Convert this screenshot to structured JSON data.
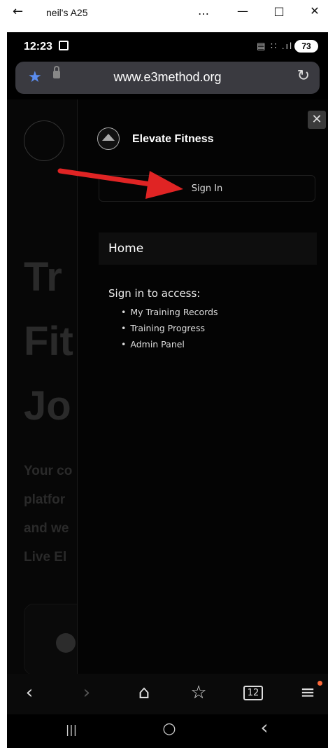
{
  "window": {
    "title": "neil's A25",
    "back_glyph": "←",
    "more_glyph": "…",
    "min_glyph": "—",
    "max_glyph": "□",
    "close_glyph": "✕"
  },
  "status": {
    "time": "12:23",
    "battery": "73",
    "signal_icons": "▤ ∷ .ıl"
  },
  "urlbar": {
    "url": "www.e3method.org",
    "star": "★",
    "reload": "↻"
  },
  "page": {
    "hero_lines": [
      "Tr",
      "Fit",
      "Jo"
    ],
    "sub_lines": [
      "Your co",
      "platfor",
      "and we",
      "Live El"
    ]
  },
  "drawer": {
    "close": "✕",
    "brand": "Elevate Fitness",
    "signin": "Sign In",
    "home": "Home",
    "access_title": "Sign in to access:",
    "access_items": [
      "My Training Records",
      "Training Progress",
      "Admin Panel"
    ]
  },
  "bottomnav": {
    "back": "‹",
    "forward": "›",
    "home": "⌂",
    "bookmarks": "☆",
    "tabs": "12",
    "menu": "≡"
  },
  "sysnav": {
    "recents": "|||",
    "home": "○",
    "back": "‹"
  },
  "colors": {
    "accent": "#5b8def",
    "arrow": "#e02424"
  }
}
